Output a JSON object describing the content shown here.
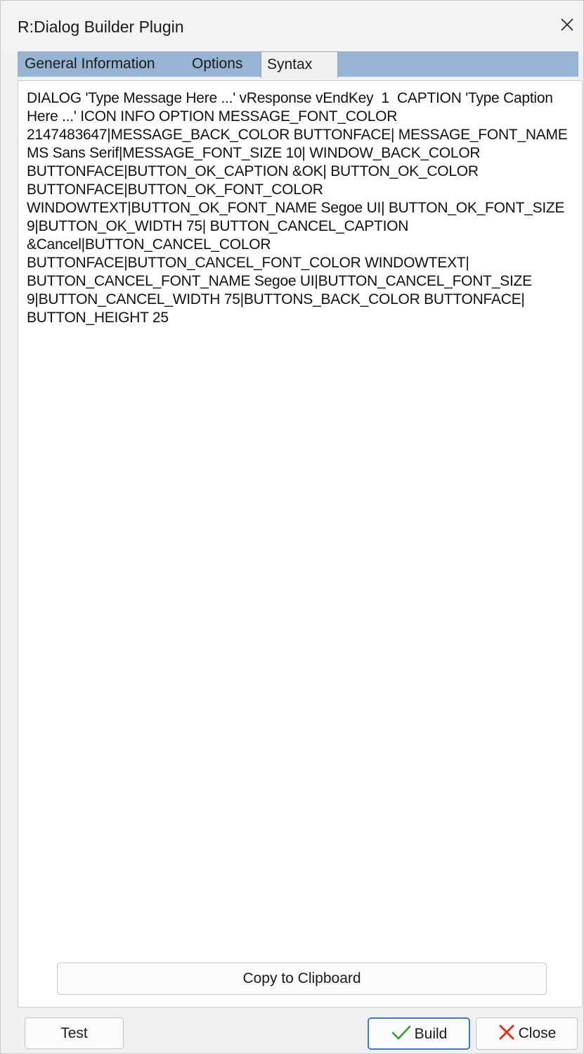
{
  "window": {
    "title": "R:Dialog Builder Plugin"
  },
  "tabs": [
    {
      "label": "General Information",
      "selected": false
    },
    {
      "label": "Options",
      "selected": false
    },
    {
      "label": "Syntax",
      "selected": true
    }
  ],
  "syntax": {
    "text": "DIALOG 'Type Message Here ...' vResponse vEndKey  1  CAPTION 'Type Caption Here ...' ICON INFO OPTION MESSAGE_FONT_COLOR 2147483647|MESSAGE_BACK_COLOR BUTTONFACE| MESSAGE_FONT_NAME MS Sans Serif|MESSAGE_FONT_SIZE 10| WINDOW_BACK_COLOR BUTTONFACE|BUTTON_OK_CAPTION &OK| BUTTON_OK_COLOR BUTTONFACE|BUTTON_OK_FONT_COLOR WINDOWTEXT|BUTTON_OK_FONT_NAME Segoe UI| BUTTON_OK_FONT_SIZE 9|BUTTON_OK_WIDTH 75| BUTTON_CANCEL_CAPTION &Cancel|BUTTON_CANCEL_COLOR BUTTONFACE|BUTTON_CANCEL_FONT_COLOR WINDOWTEXT| BUTTON_CANCEL_FONT_NAME Segoe UI|BUTTON_CANCEL_FONT_SIZE 9|BUTTON_CANCEL_WIDTH 75|BUTTONS_BACK_COLOR BUTTONFACE| BUTTON_HEIGHT 25"
  },
  "buttons": {
    "copy": "Copy to Clipboard",
    "test": "Test",
    "build": "Build",
    "close": "Close"
  },
  "icons": {
    "close_window": "close-x-icon",
    "build": "green-checkmark-icon",
    "close": "red-x-icon"
  },
  "colors": {
    "tab_strip": "#98b4d4",
    "build_border": "#3c7ec0",
    "check_green": "#2e9e3a",
    "close_red": "#e0301e"
  }
}
